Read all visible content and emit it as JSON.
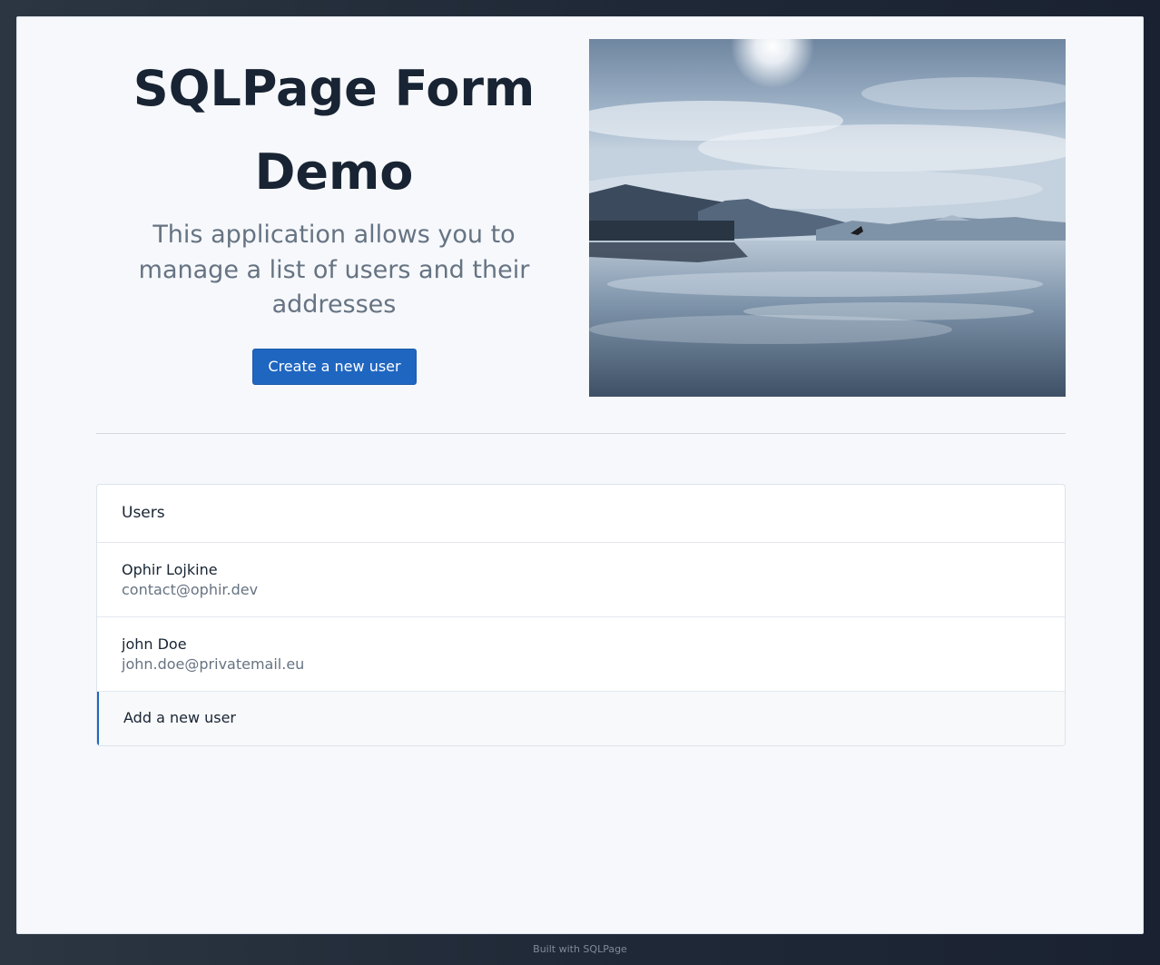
{
  "hero": {
    "title_line1": "SQLPage Form",
    "title_line2": "Demo",
    "description": "This application allows you to manage a list of users and their addresses",
    "button_label": "Create a new user",
    "image_icon": "lake-mountain-landscape-photo"
  },
  "users_list": {
    "title": "Users",
    "items": [
      {
        "name": "Ophir Lojkine",
        "email": "contact@ophir.dev"
      },
      {
        "name": "john Doe",
        "email": "john.doe@privatemail.eu"
      }
    ],
    "add_label": "Add a new user"
  },
  "footer": {
    "text": "Built with SQLPage"
  },
  "colors": {
    "primary": "#1f66c1",
    "heading": "#182433",
    "muted": "#667382",
    "page_bg": "#f6f8fb",
    "outer_bg": "#1f2937"
  }
}
